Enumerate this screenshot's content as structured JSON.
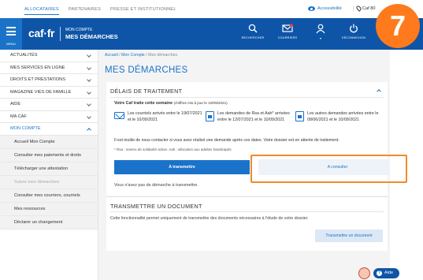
{
  "topbar": {
    "links": [
      "ALLOCATAIRES",
      "PARTENAIRES",
      "PRESSE ET INSTITUTIONNEL"
    ],
    "accessibility": "Accessibilité",
    "location": "Caf 80"
  },
  "header": {
    "menu_label": "MENU",
    "logo": "caf·fr",
    "account_small": "MON COMPTE",
    "account_title": "MES DÉMARCHES",
    "icons": [
      {
        "label": "RECHERCHER",
        "icon": "search-icon"
      },
      {
        "label": "COURRIERS",
        "icon": "mail-icon"
      },
      {
        "label": "",
        "icon": "user-icon"
      },
      {
        "label": "DÉCONNEXION",
        "icon": "power-icon"
      }
    ]
  },
  "badge": "7",
  "sidebar": {
    "items": [
      {
        "label": "ACTUALITÉS"
      },
      {
        "label": "MES SERVICES EN LIGNE"
      },
      {
        "label": "DROITS ET PRESTATIONS"
      },
      {
        "label": "MAGAZINE VIES DE FAMILLE"
      },
      {
        "label": "AIDE"
      },
      {
        "label": "MA CAF"
      },
      {
        "label": "MON COMPTE"
      }
    ],
    "sub": [
      {
        "label": "Accueil Mon Compte"
      },
      {
        "label": "Consulter mes paiements et droits"
      },
      {
        "label": "Télécharger une attestation"
      },
      {
        "label": "Suivre mes démarches"
      },
      {
        "label": "Consulter mes courriers, courriels"
      },
      {
        "label": "Mes ressources"
      },
      {
        "label": "Déclarer un changement"
      }
    ]
  },
  "breadcrumb": {
    "a": "Accueil",
    "b": "Mon Compte",
    "c": "Mes démarches",
    "sep": "/"
  },
  "page_title": "MES DÉMARCHES",
  "delais": {
    "title": "DÉLAIS DE TRAITEMENT",
    "subtitle_bold": "Votre Caf traite cette semaine",
    "subtitle_small": "(chiffres mis à jour le 10/09/2021)",
    "cols": [
      "Les courriels arrivés entre le 19/07/2021 et le 10/09/2021",
      "Les demandes de Rsa et Aah* arrivées entre le 12/07/2021 et le 10/09/2021",
      "Les autres demandes arrivées entre le 08/06/2021 et le 10/09/2021"
    ],
    "note": "Il est inutile de nous contacter si vous avez réalisé une demande après ces dates. Votre dossier est en attente de traitement.",
    "footnote": "* Rsa : revenu de solidarité active. Aah : allocation aux adultes handicapés",
    "btn_transmettre": "A transmettre",
    "btn_consulter": "A consulter",
    "empty": "Vous n'avez pas de démarche à transmettre."
  },
  "transmettre": {
    "title": "TRANSMETTRE UN DOCUMENT",
    "text": "Cette fonctionnalité permet uniquement de transmettre des documents nécessaires à l'étude de votre dossier.",
    "btn": "Transmettre un document"
  },
  "help": {
    "label": "Aide"
  },
  "colors": {
    "brand": "#0e55a7",
    "accent": "#1a73c8",
    "highlight": "#f08a2a",
    "badge": "#ff7a1c"
  }
}
